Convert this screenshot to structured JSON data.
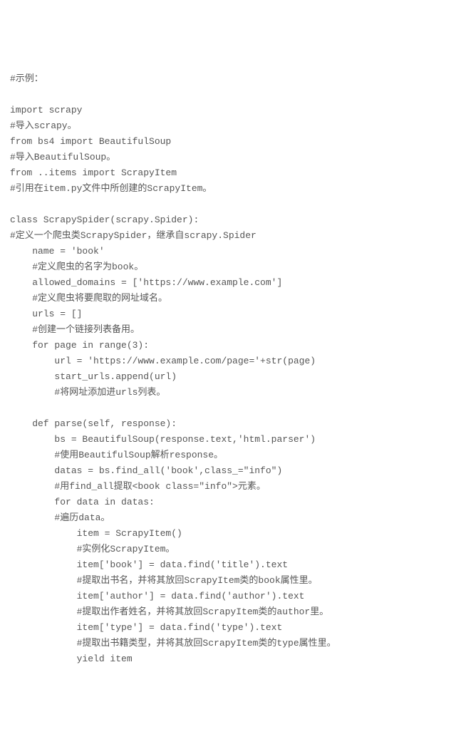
{
  "code": {
    "lines": [
      "#示例：",
      "",
      "import scrapy",
      "#导入scrapy。",
      "from bs4 import BeautifulSoup",
      "#导入BeautifulSoup。",
      "from ..items import ScrapyItem",
      "#引用在item.py文件中所创建的ScrapyItem。",
      "",
      "class ScrapySpider(scrapy.Spider):",
      "#定义一个爬虫类ScrapySpider，继承自scrapy.Spider",
      "    name = 'book'",
      "    #定义爬虫的名字为book。",
      "    allowed_domains = ['https://www.example.com']",
      "    #定义爬虫将要爬取的网址域名。",
      "    urls = []",
      "    #创建一个链接列表备用。",
      "    for page in range(3):",
      "        url = 'https://www.example.com/page='+str(page)",
      "        start_urls.append(url)",
      "        #将网址添加进urls列表。",
      "",
      "    def parse(self, response):",
      "        bs = BeautifulSoup(response.text,'html.parser')",
      "        #使用BeautifulSoup解析response。",
      "        datas = bs.find_all('book',class_=\"info\")",
      "        #用find_all提取<book class=\"info\">元素。",
      "        for data in datas:",
      "        #遍历data。",
      "            item = ScrapyItem()",
      "            #实例化ScrapyItem。",
      "            item['book'] = data.find('title').text",
      "            #提取出书名，并将其放回ScrapyItem类的book属性里。",
      "            item['author'] = data.find('author').text",
      "            #提取出作者姓名，并将其放回ScrapyItem类的author里。",
      "            item['type'] = data.find('type').text",
      "            #提取出书籍类型，并将其放回ScrapyItem类的type属性里。",
      "            yield item"
    ]
  }
}
